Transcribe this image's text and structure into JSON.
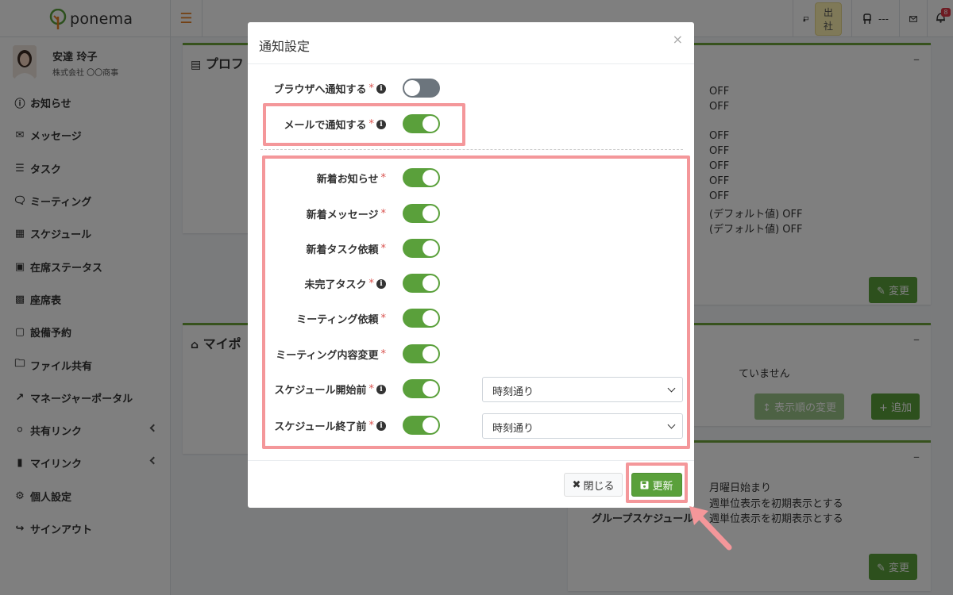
{
  "header": {
    "logo_text": "ponema",
    "status_label": "出社",
    "seat_label": "---",
    "notification_count": "8"
  },
  "sidebar": {
    "user_name": "安達 玲子",
    "company": "株式会社 〇〇商事",
    "items": [
      {
        "label": "お知らせ",
        "icon": "info-icon"
      },
      {
        "label": "メッセージ",
        "icon": "envelope-icon"
      },
      {
        "label": "タスク",
        "icon": "task-list-icon"
      },
      {
        "label": "ミーティング",
        "icon": "chat-icon"
      },
      {
        "label": "スケジュール",
        "icon": "calendar-icon"
      },
      {
        "label": "在席ステータス",
        "icon": "presence-icon"
      },
      {
        "label": "座席表",
        "icon": "chair-icon"
      },
      {
        "label": "設備予約",
        "icon": "facility-icon"
      },
      {
        "label": "ファイル共有",
        "icon": "folder-icon"
      },
      {
        "label": "マネージャーポータル",
        "icon": "chart-icon"
      },
      {
        "label": "共有リンク",
        "icon": "globe-icon"
      },
      {
        "label": "マイリンク",
        "icon": "bookmark-icon"
      },
      {
        "label": "個人設定",
        "icon": "gear-icon"
      },
      {
        "label": "サインアウト",
        "icon": "signout-icon"
      }
    ]
  },
  "background": {
    "profile_title": "プロフ",
    "mypage_title": "マイポ",
    "offs": [
      "OFF",
      "OFF",
      "OFF",
      "OFF",
      "OFF",
      "OFF",
      "OFF"
    ],
    "default_offs": [
      "(デフォルト値) OFF",
      "(デフォルト値) OFF"
    ],
    "change_label": "変更",
    "not_set_text": "ていません",
    "order_change_label": "表示順の変更",
    "add_label": "追加",
    "week_start": "月曜日始まり",
    "week_view_1": "週単位表示を初期表示とする",
    "week_view_2": "週単位表示を初期表示とする",
    "group_schedule_label": "グループスケジュール"
  },
  "modal": {
    "title": "通知設定",
    "close_x": "×",
    "rows": [
      {
        "label": "ブラウザへ通知する",
        "required": "*",
        "info": true,
        "on": false
      },
      {
        "label": "メールで通知する",
        "required": "*",
        "info": true,
        "on": true
      },
      {
        "label": "新着お知らせ",
        "required": "*",
        "info": false,
        "on": true
      },
      {
        "label": "新着メッセージ",
        "required": "*",
        "info": false,
        "on": true
      },
      {
        "label": "新着タスク依頼",
        "required": "*",
        "info": false,
        "on": true
      },
      {
        "label": "未完了タスク",
        "required": "*",
        "info": true,
        "on": true
      },
      {
        "label": "ミーティング依頼",
        "required": "*",
        "info": false,
        "on": true
      },
      {
        "label": "ミーティング内容変更",
        "required": "*",
        "info": false,
        "on": true
      },
      {
        "label": "スケジュール開始前",
        "required": "*",
        "info": true,
        "on": true,
        "select": "時刻通り"
      },
      {
        "label": "スケジュール終了前",
        "required": "*",
        "info": true,
        "on": true,
        "select": "時刻通り"
      }
    ],
    "close_button": "閉じる",
    "update_button": "更新"
  }
}
